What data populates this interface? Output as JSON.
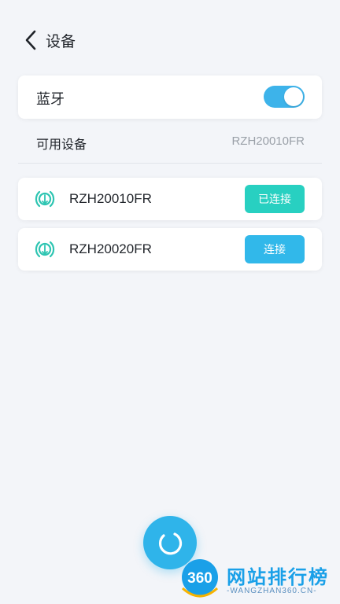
{
  "header": {
    "title": "设备"
  },
  "bluetooth": {
    "label": "蓝牙",
    "enabled": true
  },
  "available": {
    "label": "可用设备",
    "current_device": "RZH20010FR"
  },
  "devices": [
    {
      "name": "RZH20010FR",
      "button_label": "已连接",
      "status": "connected"
    },
    {
      "name": "RZH20020FR",
      "button_label": "连接",
      "status": "disconnected"
    }
  ],
  "watermark": {
    "number": "360",
    "title": "网站排行榜",
    "subtitle": "-WANGZHAN360.CN-"
  },
  "colors": {
    "accent": "#31b8ea",
    "connected": "#28d0c1",
    "device_icon": "#2ec5b2",
    "background": "#f3f5f9"
  }
}
